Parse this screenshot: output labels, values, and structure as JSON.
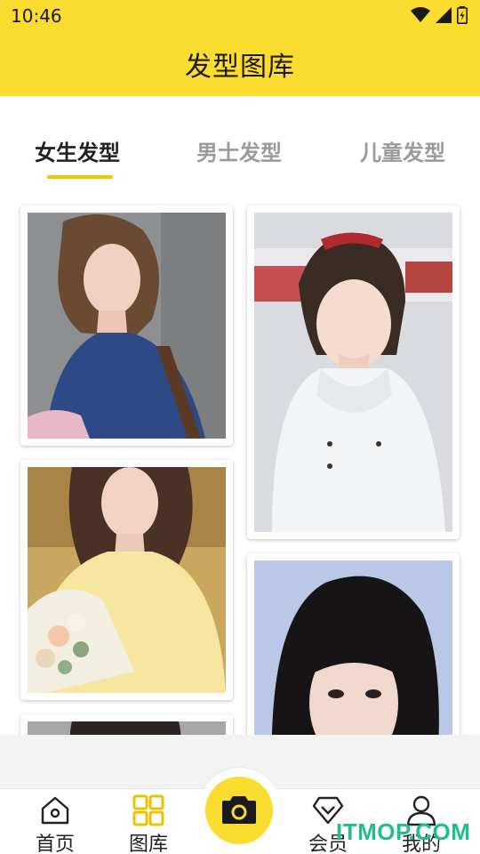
{
  "status_bar": {
    "time": "10:46"
  },
  "header": {
    "title": "发型图库"
  },
  "tabs": [
    {
      "label": "女生发型",
      "active": true
    },
    {
      "label": "男士发型",
      "active": false
    },
    {
      "label": "儿童发型",
      "active": false
    }
  ],
  "gallery": [
    {
      "name": "photo-woman-blue-sweater"
    },
    {
      "name": "photo-woman-white-jacket"
    },
    {
      "name": "photo-woman-yellow-sweater"
    },
    {
      "name": "photo-woman-bangs"
    },
    {
      "name": "photo-woman-partial"
    }
  ],
  "bottom_nav": {
    "items": [
      {
        "label": "首页",
        "icon": "home-icon"
      },
      {
        "label": "图库",
        "icon": "gallery-icon"
      },
      {
        "label": "会员",
        "icon": "vip-icon"
      },
      {
        "label": "我的",
        "icon": "user-icon"
      }
    ],
    "center_icon": "camera-icon"
  },
  "watermark": {
    "text": "ITMOP.COM"
  },
  "colors": {
    "accent": "#fbdd2f",
    "indicator": "#f5c400",
    "watermark": "#1fbf8a"
  }
}
